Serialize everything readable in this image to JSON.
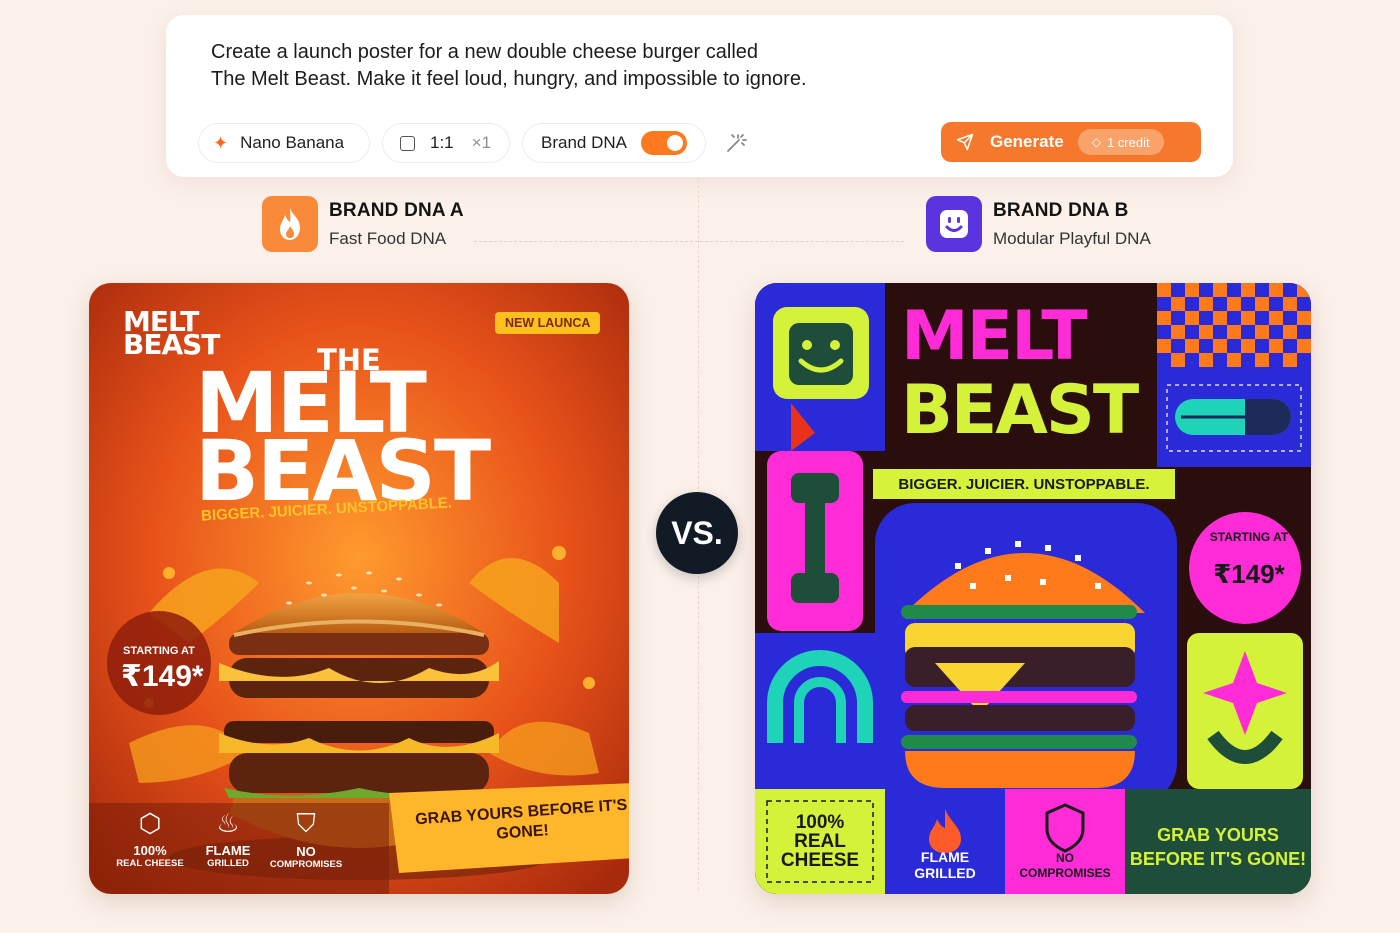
{
  "prompt": {
    "line1": "Create a launch poster for a new double cheese burger called",
    "line2": "The Melt Beast. Make it feel loud, hungry, and impossible to ignore."
  },
  "toolbar": {
    "model_label": "Nano Banana",
    "ratio_label": "1:1",
    "count_label": "×1",
    "brand_dna_label": "Brand DNA",
    "brand_dna_enabled": true,
    "generate_label": "Generate",
    "credit_label": "1 credit"
  },
  "brand_a": {
    "title": "BRAND DNA A",
    "subtitle": "Fast Food DNA",
    "icon": "flame-icon",
    "color": "#f98a3a"
  },
  "brand_b": {
    "title": "BRAND DNA B",
    "subtitle": "Modular Playful DNA",
    "icon": "smiley-icon",
    "color": "#5b34e0"
  },
  "vs_label": "VS.",
  "poster_a": {
    "logo_line1": "MELT",
    "logo_line2": "BEAST",
    "badge": "NEW LAUNCA",
    "the": "THE",
    "melt": "MELT",
    "beast": "BEAST",
    "tagline": "BIGGER. JUICIER. UNSTOPPABLE.",
    "starting_at": "STARTING AT",
    "price": "₹149*",
    "cta": "GRAB YOURS BEFORE IT'S GONE!",
    "features": [
      {
        "big": "100%",
        "small": "REAL CHEESE",
        "icon": "cheese-icon"
      },
      {
        "big": "FLAME",
        "small": "GRILLED",
        "icon": "flame-icon"
      },
      {
        "big": "NO",
        "small": "COMPROMISES",
        "icon": "shield-icon"
      }
    ]
  },
  "poster_b": {
    "melt": "MELT",
    "beast": "BEAST",
    "tagline": "BIGGER. JUICIER. UNSTOPPABLE.",
    "starting_at": "STARTING AT",
    "price": "₹149*",
    "cta_line1": "GRAB YOURS",
    "cta_line2": "BEFORE IT'S GONE!",
    "features": [
      {
        "line1": "100%",
        "line2": "REAL",
        "line3": "CHEESE"
      },
      {
        "line1": "FLAME",
        "line2": "GRILLED"
      },
      {
        "line1": "NO",
        "line2": "COMPROMISES"
      }
    ]
  }
}
